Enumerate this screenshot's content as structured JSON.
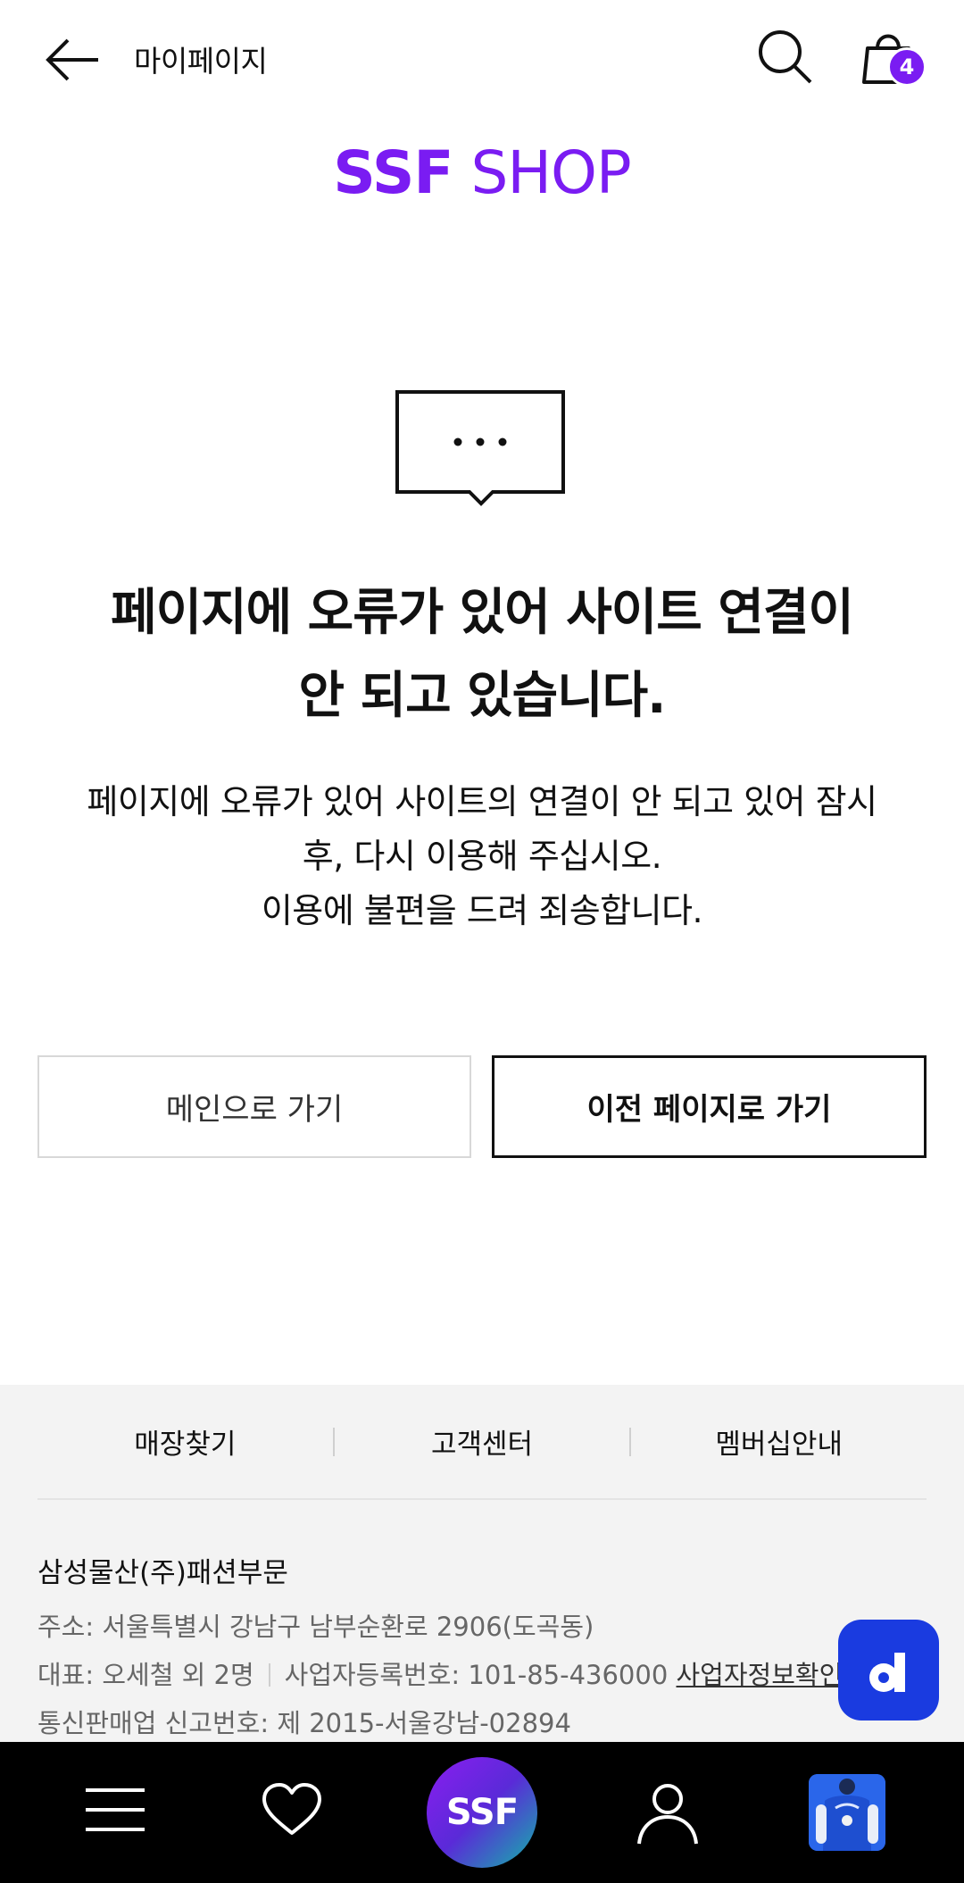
{
  "header": {
    "page_title": "마이페이지",
    "cart_count": "4",
    "logo_bold": "SSF",
    "logo_light": "SHOP"
  },
  "error": {
    "title_line1": "페이지에 오류가 있어 사이트 연결이",
    "title_line2": "안 되고 있습니다.",
    "desc_line1": "페이지에 오류가 있어 사이트의 연결이 안 되고 있어 잠시",
    "desc_line2": "후, 다시 이용해 주십시오.",
    "desc_line3": "이용에 불편을 드려 죄송합니다."
  },
  "buttons": {
    "main": "메인으로 가기",
    "prev": "이전 페이지로 가기"
  },
  "footer": {
    "links": [
      "매장찾기",
      "고객센터",
      "멤버십안내"
    ],
    "company": "삼성물산(주)패션부문",
    "address": "주소: 서울특별시 강남구 남부순환로 2906(도곡동)",
    "ceo": "대표: 오세철 외 2명",
    "biz_no": "사업자등록번호: 101-85-436000",
    "biz_link": "사업자정보확인",
    "mail_order": "통신판매업 신고번호: 제 2015-서울강남-02894"
  },
  "bottom_nav": {
    "center_label": "SSF",
    "items": [
      "menu-icon",
      "heart-icon",
      "ssf-home",
      "user-icon",
      "product-thumbnail"
    ]
  },
  "colors": {
    "brand": "#7a1cf2",
    "floating_button": "#1a3be0"
  }
}
